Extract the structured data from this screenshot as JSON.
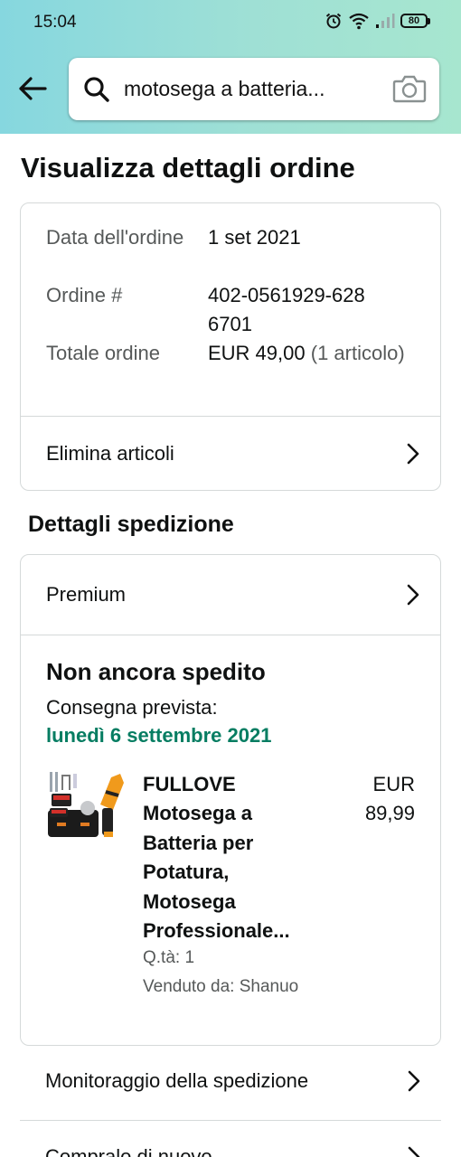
{
  "status_bar": {
    "time": "15:04",
    "battery": "80"
  },
  "search": {
    "query": "motosega a batteria..."
  },
  "page": {
    "title": "Visualizza dettagli ordine"
  },
  "order": {
    "date_label": "Data dell'ordine",
    "date_value": "1 set 2021",
    "number_label": "Ordine #",
    "number_value": "402-0561929-6286701",
    "total_label": "Totale ordine",
    "total_value": "EUR 49,00",
    "total_note": "(1 articolo)",
    "delete_items": "Elimina articoli"
  },
  "shipping": {
    "section_title": "Dettagli spedizione",
    "tier": "Premium",
    "status": "Non ancora spedito",
    "delivery_label": "Consegna prevista:",
    "delivery_date": "lunedì 6 settembre 2021",
    "product": {
      "title": "FULLOVE Motosega a Batteria per Potatura, Motosega Professionale...",
      "price": "EUR 89,99",
      "qty": "Q.tà: 1",
      "seller": "Venduto da: Shanuo"
    }
  },
  "actions": {
    "track": "Monitoraggio della spedizione",
    "buy_again": "Compralo di nuovo"
  },
  "colors": {
    "accent_green": "#067d62",
    "header_start": "#86d7df",
    "header_end": "#a7e6cf"
  }
}
